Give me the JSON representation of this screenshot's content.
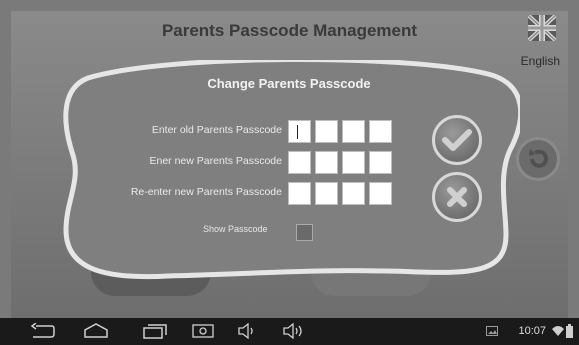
{
  "header": {
    "title": "Parents Passcode Management",
    "language": "English"
  },
  "dialog": {
    "title": "Change Parents Passcode",
    "rows": [
      {
        "label": "Enter old Parents Passcode"
      },
      {
        "label": "Ener new Parents Passcode"
      },
      {
        "label": "Re-enter new Parents Passcode"
      }
    ],
    "show_passcode_label": "Show Passcode",
    "show_passcode_checked": false
  },
  "statusbar": {
    "time": "10:07"
  },
  "icons": [
    "flag-uk-icon",
    "checkmark-icon",
    "close-icon",
    "back-icon",
    "home-icon",
    "recent-apps-icon",
    "screenshot-icon",
    "volume-down-icon",
    "volume-up-icon",
    "image-icon",
    "wifi-icon",
    "battery-icon",
    "refresh-icon"
  ]
}
